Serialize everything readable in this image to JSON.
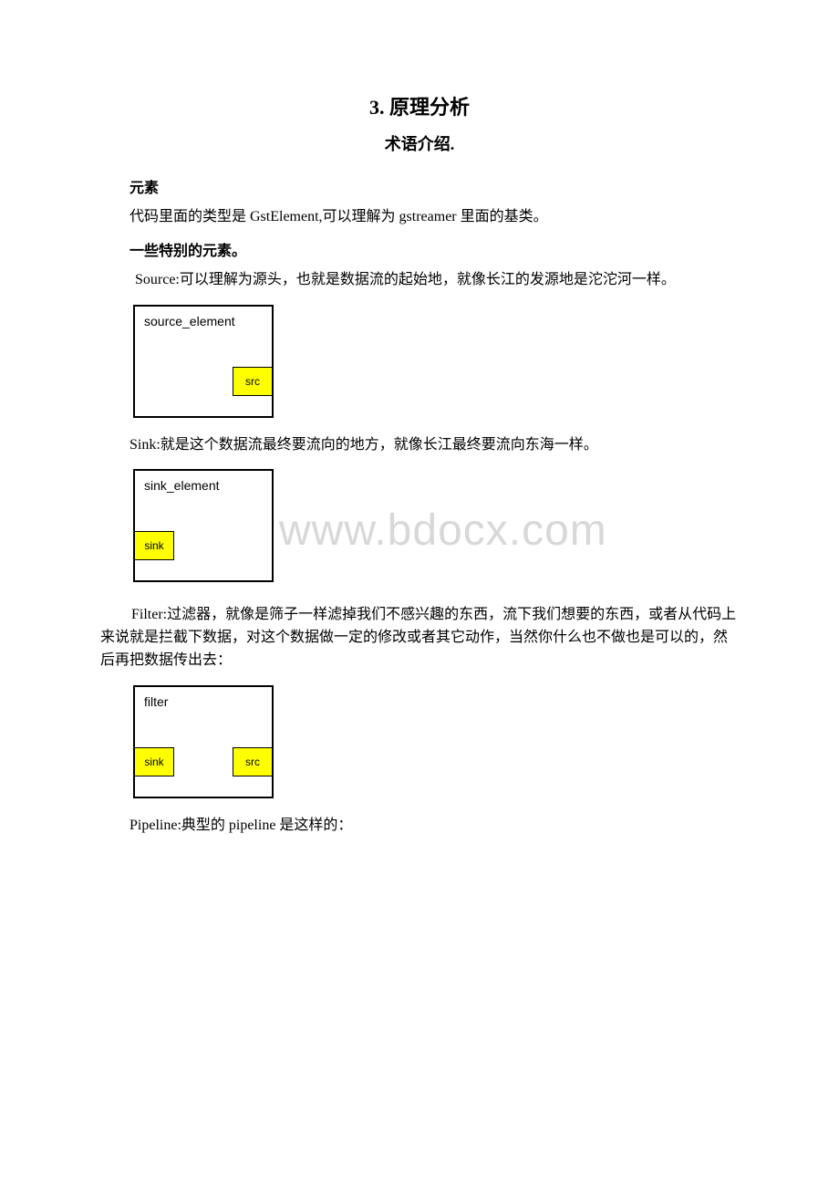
{
  "title_main": "3. 原理分析",
  "title_sub": "术语介绍.",
  "sec_element_heading": "元素",
  "sec_element_p1": "代码里面的类型是 GstElement,可以理解为 gstreamer 里面的基类。",
  "sec_special_heading": "一些特别的元素。",
  "sec_source_p": " Source:可以理解为源头，也就是数据流的起始地，就像长江的发源地是沱沱河一样。",
  "diagram_source": {
    "label": "source_element",
    "pad_src": "src"
  },
  "sec_sink_p": "Sink:就是这个数据流最终要流向的地方，就像长江最终要流向东海一样。",
  "diagram_sink": {
    "label": "sink_element",
    "pad_sink": "sink"
  },
  "watermark": "www.bdocx.com",
  "sec_filter_p": "Filter:过滤器，就像是筛子一样滤掉我们不感兴趣的东西，流下我们想要的东西，或者从代码上来说就是拦截下数据，对这个数据做一定的修改或者其它动作，当然你什么也不做也是可以的，然后再把数据传出去：",
  "diagram_filter": {
    "label": "filter",
    "pad_sink": "sink",
    "pad_src": "src"
  },
  "sec_pipeline_p": "Pipeline:典型的 pipeline 是这样的："
}
